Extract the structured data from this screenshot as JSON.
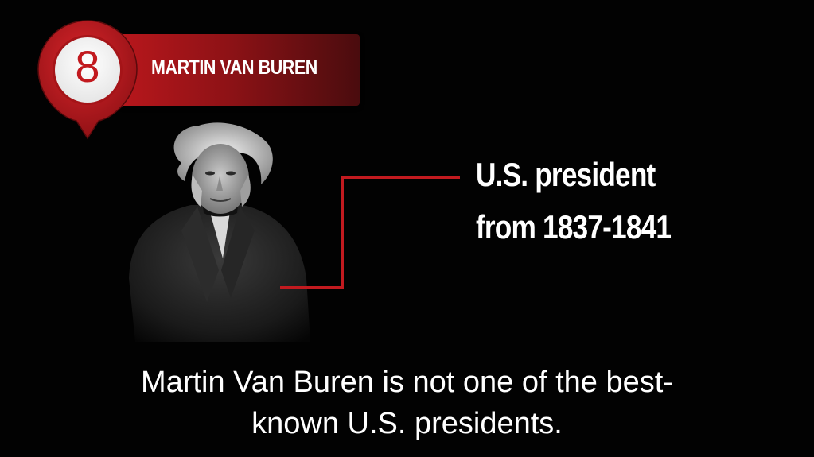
{
  "rank": "8",
  "title": "MARTIN VAN BUREN",
  "fact": {
    "line1": "U.S. president",
    "line2": "from 1837-1841"
  },
  "caption": {
    "line1": "Martin Van Buren is not one of the best-",
    "line2": "known U.S. presidents."
  },
  "colors": {
    "accent": "#c21a1f",
    "background": "#020202",
    "text": "#ffffff"
  },
  "portrait": {
    "icon": "portrait-engraving"
  }
}
